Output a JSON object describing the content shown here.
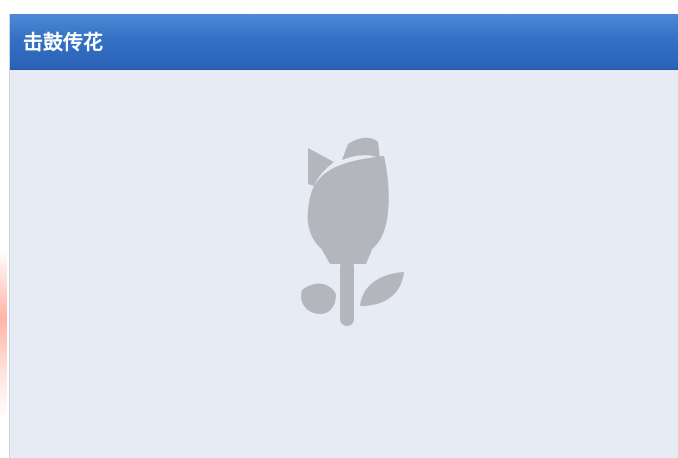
{
  "window": {
    "title": "击鼓传花"
  },
  "content": {
    "placeholder_icon": "rose-icon"
  },
  "colors": {
    "titlebar": "#3471c4",
    "panel_background": "#e6ebf4",
    "icon": "#b3b6bc"
  }
}
